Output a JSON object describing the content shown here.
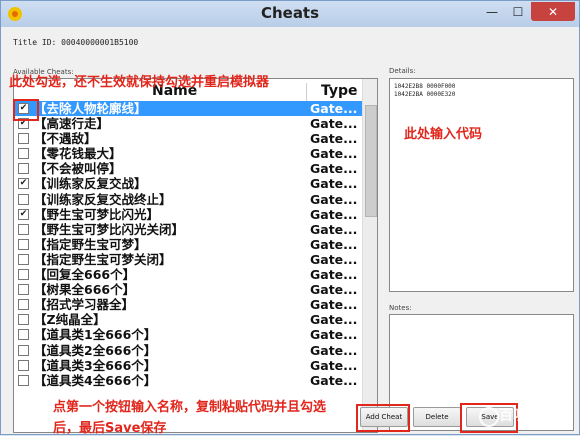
{
  "window": {
    "title": "Cheats"
  },
  "title_id": "Title ID: 00040000001B5100",
  "available_label": "Available Cheats:",
  "details_label": "Details:",
  "notes_label": "Notes:",
  "columns": {
    "name": "Name",
    "type": "Type"
  },
  "cheats": [
    {
      "name": "【去除人物轮廓线】",
      "type": "Gate...",
      "checked": true,
      "selected": true
    },
    {
      "name": "【高速行走】",
      "type": "Gate...",
      "checked": true
    },
    {
      "name": "【不遇敌】",
      "type": "Gate...",
      "checked": false
    },
    {
      "name": "【零花钱最大】",
      "type": "Gate...",
      "checked": false
    },
    {
      "name": "【不会被叫停】",
      "type": "Gate...",
      "checked": false
    },
    {
      "name": "【训练家反复交战】",
      "type": "Gate...",
      "checked": true
    },
    {
      "name": "【训练家反复交战终止】",
      "type": "Gate...",
      "checked": false
    },
    {
      "name": "【野生宝可梦比闪光】",
      "type": "Gate...",
      "checked": true
    },
    {
      "name": "【野生宝可梦比闪光关闭】",
      "type": "Gate...",
      "checked": false
    },
    {
      "name": "【指定野生宝可梦】",
      "type": "Gate...",
      "checked": false
    },
    {
      "name": "【指定野生宝可梦关闭】",
      "type": "Gate...",
      "checked": false
    },
    {
      "name": "【回复全666个】",
      "type": "Gate...",
      "checked": false
    },
    {
      "name": "【树果全666个】",
      "type": "Gate...",
      "checked": false
    },
    {
      "name": "【招式学习器全】",
      "type": "Gate...",
      "checked": false
    },
    {
      "name": "【Z纯晶全】",
      "type": "Gate...",
      "checked": false
    },
    {
      "name": "【道具类1全666个】",
      "type": "Gate...",
      "checked": false
    },
    {
      "name": "【道具类2全666个】",
      "type": "Gate...",
      "checked": false
    },
    {
      "name": "【道具类3全666个】",
      "type": "Gate...",
      "checked": false
    },
    {
      "name": "【道具类4全666个】",
      "type": "Gate...",
      "checked": false
    }
  ],
  "details_lines": [
    "1042E2B8 0000F000",
    "1042E2BA 0000E320"
  ],
  "buttons": {
    "add": "Add Cheat",
    "delete": "Delete",
    "save": "Save"
  },
  "annotations": {
    "top": "此处勾选，还不生效就保持勾选并重启模拟器",
    "right": "此处输入代码",
    "bottom1": "点第一个按钮输入名称，复制粘贴代码并且勾选",
    "bottom2": "后，最后Save保存"
  },
  "watermark": "百叭克",
  "colors": {
    "annotation": "#e1261c",
    "selection": "#3399ff",
    "close": "#c7433f"
  }
}
